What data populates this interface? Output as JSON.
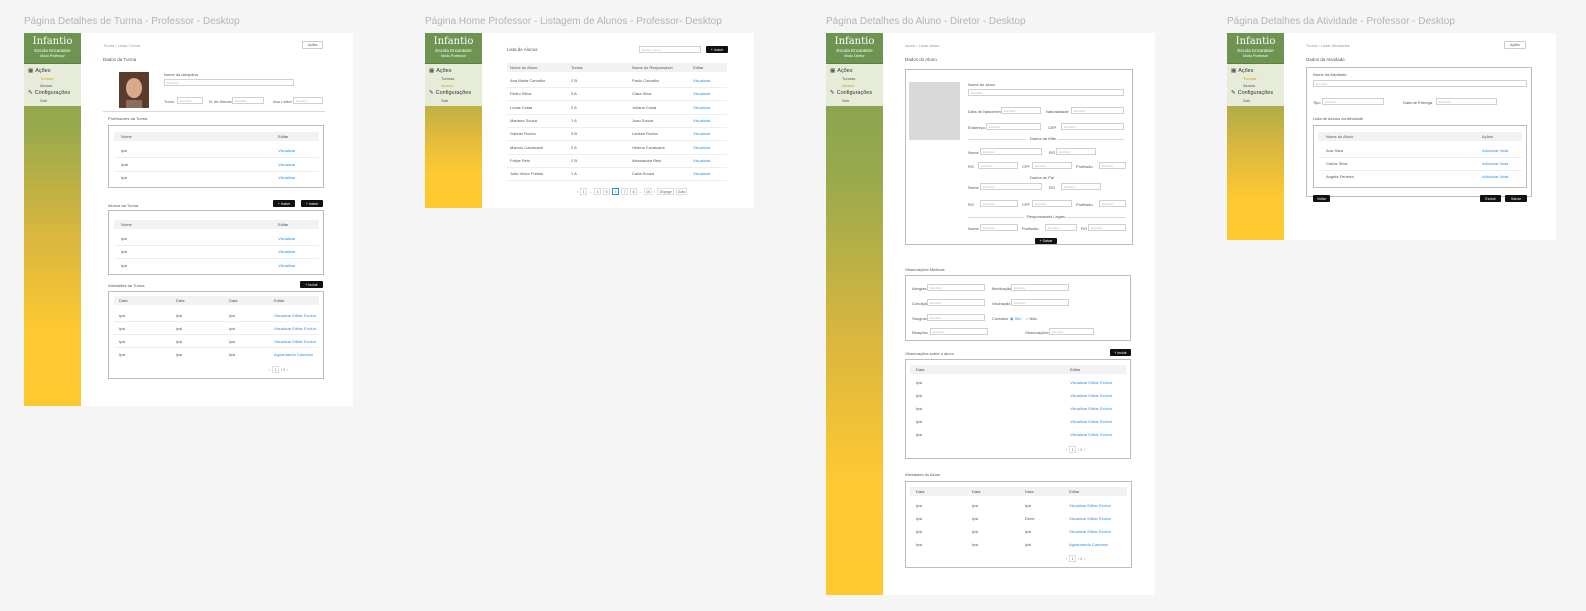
{
  "frames": [
    {
      "title": "Página Detalhes de Turma - Professor  - Desktop",
      "sidebar": {
        "logo": "Infantio",
        "school": "Escola Encantaire",
        "role": "Modo Professor",
        "section1": "Ações",
        "items1": [
          "Turmas",
          "Alunos"
        ],
        "active1": 0,
        "section2": "Configurações",
        "items2": [
          "Sair"
        ]
      },
      "breadcrumb": "Turma / Listar Turma",
      "actions_btn": "Ações",
      "section_title": "Dados da Turma",
      "labels": {
        "class_name": "Nome da disciplina",
        "name_ph": "Escolher",
        "shift": "Turno",
        "capacity": "N. de Alunos",
        "year": "Ano Letivo",
        "value_ph": "Escolher"
      },
      "teachers": {
        "title": "Professores da Turma",
        "headers": [
          "Nome",
          "Editar"
        ],
        "rows": [
          [
            "Ipsi",
            "Visualizar"
          ],
          [
            "Ipsli",
            "Visualizar"
          ],
          [
            "Ipsi",
            "Visualizar"
          ]
        ]
      },
      "students": {
        "title": "Alunos da Turma",
        "btn1": "+ Incluir",
        "btn2": "+ Incluir",
        "headers": [
          "Nome",
          "Editar"
        ],
        "rows": [
          [
            "Ipsi",
            "Visualizar"
          ],
          [
            "Ipsi",
            "Visualizar"
          ],
          [
            "Ipsi",
            "Visualizar"
          ]
        ]
      },
      "activities": {
        "title": "Atividades da Turma",
        "add_btn": "+ Incluir",
        "headers": [
          "Data",
          "Data",
          "Data",
          "Editar"
        ],
        "rows": [
          [
            "Ipsi",
            "Ipsi",
            "Ipsi",
            "Visualizar  Editar  Excluir"
          ],
          [
            "Ipsi",
            "Ipsi",
            "Ipsi",
            "Visualizar  Editar  Excluir"
          ],
          [
            "Ipsi",
            "Ipsi",
            "Ipsi",
            "Visualizar  Editar  Excluir"
          ],
          [
            "Ipsi",
            "Ipsi",
            "Ipsi",
            "Aguardando  Cancelar"
          ]
        ],
        "pager": [
          "‹",
          "1",
          "/ 2",
          "›"
        ]
      }
    },
    {
      "title": "Página Home Professor - Listagem de Alunos - Professor- Desktop",
      "sidebar": {
        "logo": "Infantio",
        "school": "Escola Encantaire",
        "role": "Modo Professor",
        "section1": "Ações",
        "items1": [
          "Turmas",
          "Alunos"
        ],
        "active1": 1,
        "section2": "Configurações",
        "items2": [
          "Sair"
        ]
      },
      "list_title": "Lista de Alunos",
      "search_ph": "Buscar Turma",
      "add_btn": "+ Incluir",
      "headers": [
        "Nome do Aluno",
        "Turma",
        "Nome do Responsável",
        "Editar"
      ],
      "rows": [
        [
          "Ana Maria Carvalho",
          "2 B",
          "Paulo Carvalho",
          "Visualizar"
        ],
        [
          "Pedro Sillva",
          "3 A",
          "Clara Silva",
          "Visualizar"
        ],
        [
          "Lucas Costa",
          "2 A",
          "Juliana Costa",
          "Visualizar"
        ],
        [
          "Mariana Souza",
          "1 A",
          "Joao Souza",
          "Visualizar"
        ],
        [
          "Gabriel Rocha",
          "3 B",
          "Larissa Rocha",
          "Visualizar"
        ],
        [
          "Marcos Cavalcanti",
          "2 A",
          "Helena Cavalcanti",
          "Visualizar"
        ],
        [
          "Felipe Reis",
          "2 B",
          "Alessandra Reis",
          "Visualizar"
        ],
        [
          "João Victor Freitas",
          "1 A",
          "Carla Souza",
          "Visualizar"
        ]
      ],
      "pager": [
        "‹",
        "1",
        "...",
        "4",
        "5",
        "6",
        "7",
        "8",
        "...",
        "10",
        "›",
        "10/page",
        "Goto"
      ]
    },
    {
      "title": "Página Detalhes do Aluno - Diretor - Desktop",
      "sidebar": {
        "logo": "Infantio",
        "school": "Escola Encantaire",
        "role": "Modo Diretor",
        "section1": "Ações",
        "items1": [
          "Turmas",
          "Alunos"
        ],
        "active1": 1,
        "section2": "Configurações",
        "items2": [
          "Sair"
        ]
      },
      "breadcrumb": "Aluno / Listar Aluno",
      "data_title": "Dados do Aluno",
      "labels": {
        "name": "Nome do aluno",
        "birth": "Data de Nascimento",
        "nat": "Naturalidade",
        "id": "Endereço",
        "cpf": "CEP",
        "mother_sec": "Dados da Mãe",
        "name2": "Nome",
        "rg": "RG",
        "cpf2": "CPF",
        "prof": "Profissão",
        "father_sec": "Dados do Pai",
        "resp_sec": "Responsáveis Legais",
        "btn_save": "+ Salvar"
      },
      "ph": "Escolher",
      "med_title": "Observações Médicas",
      "med_labels": [
        "Alergias",
        "Medicação",
        "Condição",
        "Vacinação",
        "Sanguíneo",
        "Contatos",
        "Reações",
        "Observações"
      ],
      "med_yes": "Sim",
      "med_no": "Não",
      "obs_title": "Observações sobre o aluno",
      "obs_btn": "+ Incluir",
      "obs_headers": [
        "Data",
        "Editar"
      ],
      "obs_rows": [
        "Ipsi",
        "Ipsi",
        "Ipsi",
        "Ipsi",
        "Ipsi"
      ],
      "obs_actions": "Visualizar  Editar  Excluir",
      "act_title": "Atividades do Aluno",
      "act_headers": [
        "Data",
        "Data",
        "Data",
        "Editar"
      ],
      "act_rows": [
        [
          "Ipsi",
          "Ipsi",
          "Ipsi",
          "Visualizar  Editar  Excluir"
        ],
        [
          "Ipsi",
          "Ipsi",
          "Done",
          "Visualizar  Editar  Excluir"
        ],
        [
          "Ipsi",
          "Ipsi",
          "Ipsi",
          "Visualizar  Editar  Excluir"
        ],
        [
          "Ipsi",
          "Ipsi",
          "Ipsi",
          "Aguardando  Cancelar"
        ]
      ],
      "pager": [
        "‹",
        "1",
        "/ 2",
        "›"
      ]
    },
    {
      "title": "Página Detalhes da Atividade - Professor  - Desktop",
      "sidebar": {
        "logo": "Infantio",
        "school": "Escola Encantaire",
        "role": "Modo Professor",
        "section1": "Ações",
        "items1": [
          "Turmas",
          "Alunos"
        ],
        "active1": 0,
        "section2": "Configurações",
        "items2": [
          "Sair"
        ]
      },
      "breadcrumb": "Turma / Listar Atividades",
      "actions_btn": "Ações",
      "section_title": "Dados da Atividade",
      "labels": {
        "name": "Nome da Atividade",
        "ph": "Escolher",
        "type": "Tipo",
        "date": "Data de Entrega"
      },
      "list_title": "Lista de Alunos da Atividade",
      "headers": [
        "Nome do Aluno",
        "Ações"
      ],
      "rows": [
        [
          "Ana Silva",
          "Adicionar Nota"
        ],
        [
          "Carlos Silva",
          "Adicionar Nota"
        ],
        [
          "Angela Ferreira",
          "Adicionar Nota"
        ]
      ],
      "btn_back": "Voltar",
      "btn_del": "Excluir",
      "btn_save": "Salvar"
    }
  ]
}
